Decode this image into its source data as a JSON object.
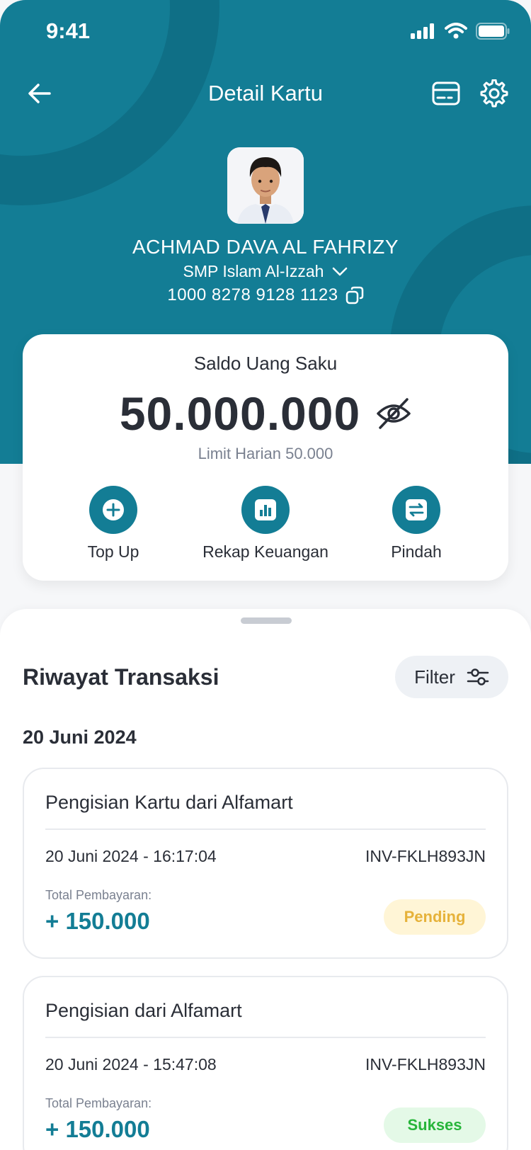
{
  "status_bar": {
    "time": "9:41"
  },
  "header": {
    "title": "Detail Kartu"
  },
  "profile": {
    "name": "ACHMAD DAVA AL FAHRIZY",
    "school": "SMP Islam Al-Izzah",
    "card_number": "1000 8278 9128 1123"
  },
  "balance": {
    "label": "Saldo Uang Saku",
    "amount": "50.000.000",
    "limit": "Limit Harian 50.000"
  },
  "actions": [
    {
      "label": "Top Up",
      "icon": "plus-circle-icon"
    },
    {
      "label": "Rekap Keuangan",
      "icon": "bar-chart-icon"
    },
    {
      "label": "Pindah",
      "icon": "transfer-icon"
    }
  ],
  "history": {
    "title": "Riwayat Transaksi",
    "filter_label": "Filter",
    "date_heading": "20 Juni 2024",
    "transactions": [
      {
        "title": "Pengisian Kartu dari Alfamart",
        "datetime": "20 Juni 2024 - 16:17:04",
        "invoice": "INV-FKLH893JN",
        "total_label": "Total Pembayaran:",
        "amount": "+ 150.000",
        "status": "Pending"
      },
      {
        "title": "Pengisian dari Alfamart",
        "datetime": "20 Juni 2024 - 15:47:08",
        "invoice": "INV-FKLH893JN",
        "total_label": "Total Pembayaran:",
        "amount": "+ 150.000",
        "status": "Sukses"
      }
    ]
  },
  "colors": {
    "primary": "#137d95",
    "pending_text": "#e6b23a",
    "pending_bg": "#fff5d6",
    "success_text": "#27b53a",
    "success_bg": "#e4f9e7"
  }
}
